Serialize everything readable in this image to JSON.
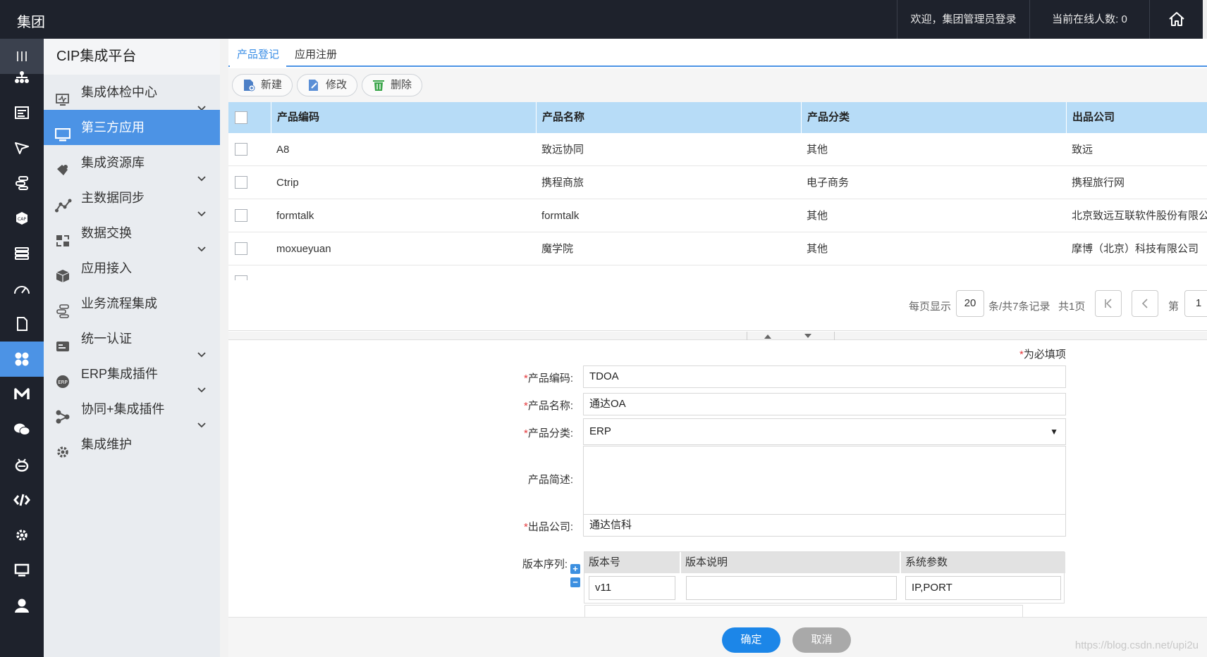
{
  "topbar": {
    "brand": "集团",
    "welcome": "欢迎，集团管理员登录",
    "online": "当前在线人数: 0"
  },
  "rail": [
    "menu-icon",
    "org-chart-icon",
    "form-icon",
    "send-icon",
    "flow-icon",
    "cap-badge-icon",
    "stack-icon",
    "gauge-icon",
    "document-icon",
    "apps-icon",
    "m-logo-icon",
    "wechat-icon",
    "robot-icon",
    "code-icon",
    "gear-icon",
    "monitor-icon",
    "user-icon"
  ],
  "sidebar": {
    "title": "CIP集成平台",
    "items": [
      {
        "label": "集成体检中心",
        "icon": "health-check-icon",
        "expandable": true,
        "active": false
      },
      {
        "label": "第三方应用",
        "icon": "monitor-icon",
        "expandable": false,
        "active": true
      },
      {
        "label": "集成资源库",
        "icon": "puzzle-icon",
        "expandable": true,
        "active": false
      },
      {
        "label": "主数据同步",
        "icon": "line-chart-icon",
        "expandable": true,
        "active": false
      },
      {
        "label": "数据交换",
        "icon": "exchange-icon",
        "expandable": true,
        "active": false
      },
      {
        "label": "应用接入",
        "icon": "cube-icon",
        "expandable": false,
        "active": false
      },
      {
        "label": "业务流程集成",
        "icon": "flow-icon",
        "expandable": false,
        "active": false
      },
      {
        "label": "统一认证",
        "icon": "id-card-icon",
        "expandable": true,
        "active": false
      },
      {
        "label": "ERP集成插件",
        "icon": "erp-icon",
        "expandable": true,
        "active": false
      },
      {
        "label": "协同+集成插件",
        "icon": "share-icon",
        "expandable": true,
        "active": false
      },
      {
        "label": "集成维护",
        "icon": "gear-icon",
        "expandable": false,
        "active": false
      }
    ]
  },
  "tabs": [
    "产品登记",
    "应用注册"
  ],
  "toolbar": {
    "new": "新建",
    "edit": "修改",
    "delete": "删除"
  },
  "grid": {
    "headers": [
      "产品编码",
      "产品名称",
      "产品分类",
      "出品公司"
    ],
    "rows": [
      [
        "A8",
        "致远协同",
        "其他",
        "致远"
      ],
      [
        "Ctrip",
        "携程商旅",
        "电子商务",
        "携程旅行网"
      ],
      [
        "formtalk",
        "formtalk",
        "其他",
        "北京致远互联软件股份有限公"
      ],
      [
        "moxueyuan",
        "魔学院",
        "其他",
        "摩博（北京）科技有限公司"
      ]
    ]
  },
  "pager": {
    "per_page_label": "每页显示",
    "per_page": "20",
    "records": "条/共7条记录",
    "pages": "共1页",
    "page_label": "第",
    "page": "1"
  },
  "form": {
    "required_note": "为必填项",
    "code_label": "产品编码:",
    "code": "TDOA",
    "name_label": "产品名称:",
    "name": "通达OA",
    "category_label": "产品分类:",
    "category": "ERP",
    "desc_label": "产品简述:",
    "desc": "",
    "company_label": "出品公司:",
    "company": "通达信科",
    "versions_label": "版本序列:",
    "version_headers": [
      "版本号",
      "版本说明",
      "系统参数"
    ],
    "version_row": {
      "number": "v11",
      "note": "",
      "params": "IP,PORT"
    }
  },
  "footer": {
    "ok": "确定",
    "cancel": "取消",
    "watermark": "https://blog.csdn.net/upi2u"
  },
  "colors": {
    "accent": "#4c93e5",
    "dark": "#1e222c",
    "header_blue": "#b7dcf7",
    "required": "#e4393c",
    "ok_button": "#1c86e8",
    "cancel_button": "#a9a9a9"
  }
}
